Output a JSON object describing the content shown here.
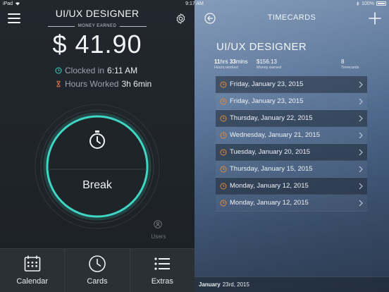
{
  "status_bar": {
    "device": "iPad",
    "time": "9:17 AM",
    "battery": "100%"
  },
  "left": {
    "job_title": "UI/UX DESIGNER",
    "money_label": "MONEY EARNED",
    "money_value": "$ 41.90",
    "clocked_in_label": "Clocked in",
    "clocked_in_time": "6:11 AM",
    "hours_worked_label": "Hours Worked",
    "hours_worked_value": "3h 6min",
    "break_label": "Break",
    "users_label": "Users",
    "tabs": [
      {
        "label": "Calendar",
        "icon": "calendar-icon"
      },
      {
        "label": "Cards",
        "icon": "clock-icon"
      },
      {
        "label": "Extras",
        "icon": "list-icon"
      }
    ]
  },
  "right": {
    "title": "TIMECARDS",
    "job_title": "UI/UX DESIGNER",
    "stats": {
      "hours_num": "11",
      "hours_unit": "hrs",
      "mins_num": "33",
      "mins_unit": "mins",
      "hours_label": "Hours worked",
      "money_value": "$156.13",
      "money_label": "Money earned",
      "timecards_count": "8",
      "timecards_label": "Timecards"
    },
    "timecards": [
      "Friday, January 23, 2015",
      "Friday, January 23, 2015",
      "Thursday, January 22, 2015",
      "Wednesday, January 21, 2015",
      "Tuesday, January 20, 2015",
      "Thursday, January 15, 2015",
      "Monday, January 12, 2015",
      "Monday, January 12, 2015"
    ],
    "footer_month": "January",
    "footer_day": "23rd, 2015"
  },
  "colors": {
    "accent_teal": "#3fd6c4",
    "accent_orange": "#e08a3c",
    "ring_dim": "#3a4148"
  }
}
